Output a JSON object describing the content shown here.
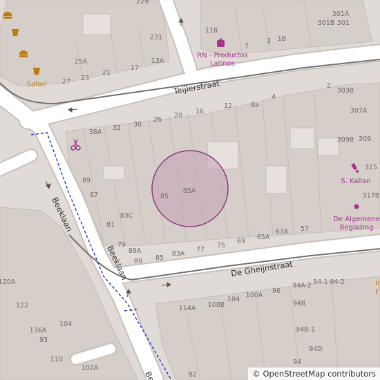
{
  "map": {
    "colors": {
      "background": "#e0dbd6",
      "building": "#d6cfc9",
      "building_outline": "#c5bcb5",
      "road": "#ffffff",
      "road_casing": "#c8c0b9",
      "rail": "#707070",
      "boundary": "#0c1fd8",
      "marker_fill": "#c7a0b8",
      "marker_stroke": "#8a3a7e",
      "poi": "#a2368f",
      "food": "#c17b07"
    },
    "streets": {
      "teijlerstraat": "Teijlerstraat",
      "de_gheijnstraat": "De Gheijnstraat",
      "beeklaan_1": "Beeklaan",
      "beeklaan_2": "Beeklaan",
      "beeklaan_3": "Be"
    },
    "pois": {
      "rn": "RN - Productos",
      "rn2": "Latinos",
      "kallan": "S. Kallan",
      "algemene1": "De Algemene",
      "algemene2": "Beglazing",
      "safari": "Safari"
    },
    "house_numbers": {
      "n229": "229",
      "n231": "231",
      "n25A": "25A",
      "n21": "21",
      "n17": "17",
      "n13A": "13A",
      "n27": "27",
      "n23": "23",
      "n118": "118",
      "n7": "7",
      "n3": "3",
      "n1B": "1B",
      "n301A": "301A",
      "n301B": "301B",
      "n301": "301",
      "n2": "2",
      "n303B": "303B",
      "n307A": "307A",
      "n309B": "309B",
      "n309": "309",
      "n315": "315",
      "n317B": "317B",
      "n4": "4",
      "n8a": "8a",
      "n12": "12",
      "n16": "16",
      "n20": "20",
      "n26": "26",
      "n30": "30",
      "n32": "32",
      "n38A": "38A",
      "n89": "89",
      "n87": "87",
      "n83C": "83C",
      "n81": "81",
      "n85": "85",
      "n85A": "85A",
      "n79": "79",
      "n89A": "89A",
      "n89b": "89",
      "n85b": "85",
      "n83A": "83A",
      "n77": "77",
      "n75": "75",
      "n69": "69",
      "n65A": "65A",
      "n63A": "63A",
      "n57": "57",
      "n120A": "120A",
      "n122": "122",
      "n136A": "136A",
      "n93": "93",
      "n104": "104",
      "n110": "110",
      "n102A": "102A",
      "n114A": "114A",
      "n108B": "108B",
      "n104b": "104",
      "n100A": "100A",
      "n96": "96",
      "n94A2": "94A-2",
      "n94_1": "94-1",
      "n94_2": "94-2",
      "n94B": "94B",
      "n94B1": "94B-1",
      "n94D": "94D",
      "n82": "82",
      "n94": "94"
    },
    "attribution": {
      "symbol": "©",
      "text": "OpenStreetMap contributors"
    },
    "right_edge_text": "Ir",
    "right_edge_text2": "F"
  }
}
